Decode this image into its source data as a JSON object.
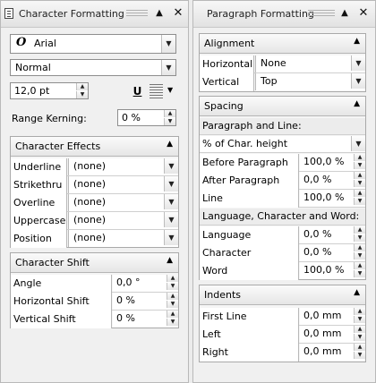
{
  "character_panel": {
    "title": "Character Formatting",
    "font": {
      "value": "Arial",
      "icon": "opentype-font-icon",
      "icon_glyph": "O"
    },
    "style": "Normal",
    "size": "12,0 pt",
    "underline_glyph": "U",
    "range_kerning": {
      "label": "Range Kerning:",
      "value": "0 %"
    },
    "effects": {
      "header": "Character Effects",
      "rows": [
        {
          "label": "Underline",
          "value": "(none)"
        },
        {
          "label": "Strikethru",
          "value": "(none)"
        },
        {
          "label": "Overline",
          "value": "(none)"
        },
        {
          "label": "Uppercase",
          "value": "(none)"
        },
        {
          "label": "Position",
          "value": "(none)"
        }
      ]
    },
    "shift": {
      "header": "Character Shift",
      "rows": [
        {
          "label": "Angle",
          "value": "0,0 °"
        },
        {
          "label": "Horizontal Shift",
          "value": "0 %"
        },
        {
          "label": "Vertical Shift",
          "value": "0 %"
        }
      ]
    }
  },
  "paragraph_panel": {
    "title": "Paragraph Formatting",
    "alignment": {
      "header": "Alignment",
      "rows": [
        {
          "label": "Horizontal",
          "value": "None"
        },
        {
          "label": "Vertical",
          "value": "Top"
        }
      ]
    },
    "spacing": {
      "header": "Spacing",
      "para_line_header": "Paragraph and Line:",
      "unit": "% of Char. height",
      "para_rows": [
        {
          "label": "Before Paragraph",
          "value": "100,0 %"
        },
        {
          "label": "After Paragraph",
          "value": "0,0 %"
        },
        {
          "label": "Line",
          "value": "100,0 %"
        }
      ],
      "lcw_header": "Language, Character and Word:",
      "lcw_rows": [
        {
          "label": "Language",
          "value": "0,0 %"
        },
        {
          "label": "Character",
          "value": "0,0 %"
        },
        {
          "label": "Word",
          "value": "100,0 %"
        }
      ]
    },
    "indents": {
      "header": "Indents",
      "rows": [
        {
          "label": "First Line",
          "value": "0,0 mm"
        },
        {
          "label": "Left",
          "value": "0,0 mm"
        },
        {
          "label": "Right",
          "value": "0,0 mm"
        }
      ]
    }
  },
  "icons": {
    "collapse": "▲",
    "dropdown": "▼",
    "close": "✕",
    "spin_up": "▲",
    "spin_down": "▼"
  }
}
